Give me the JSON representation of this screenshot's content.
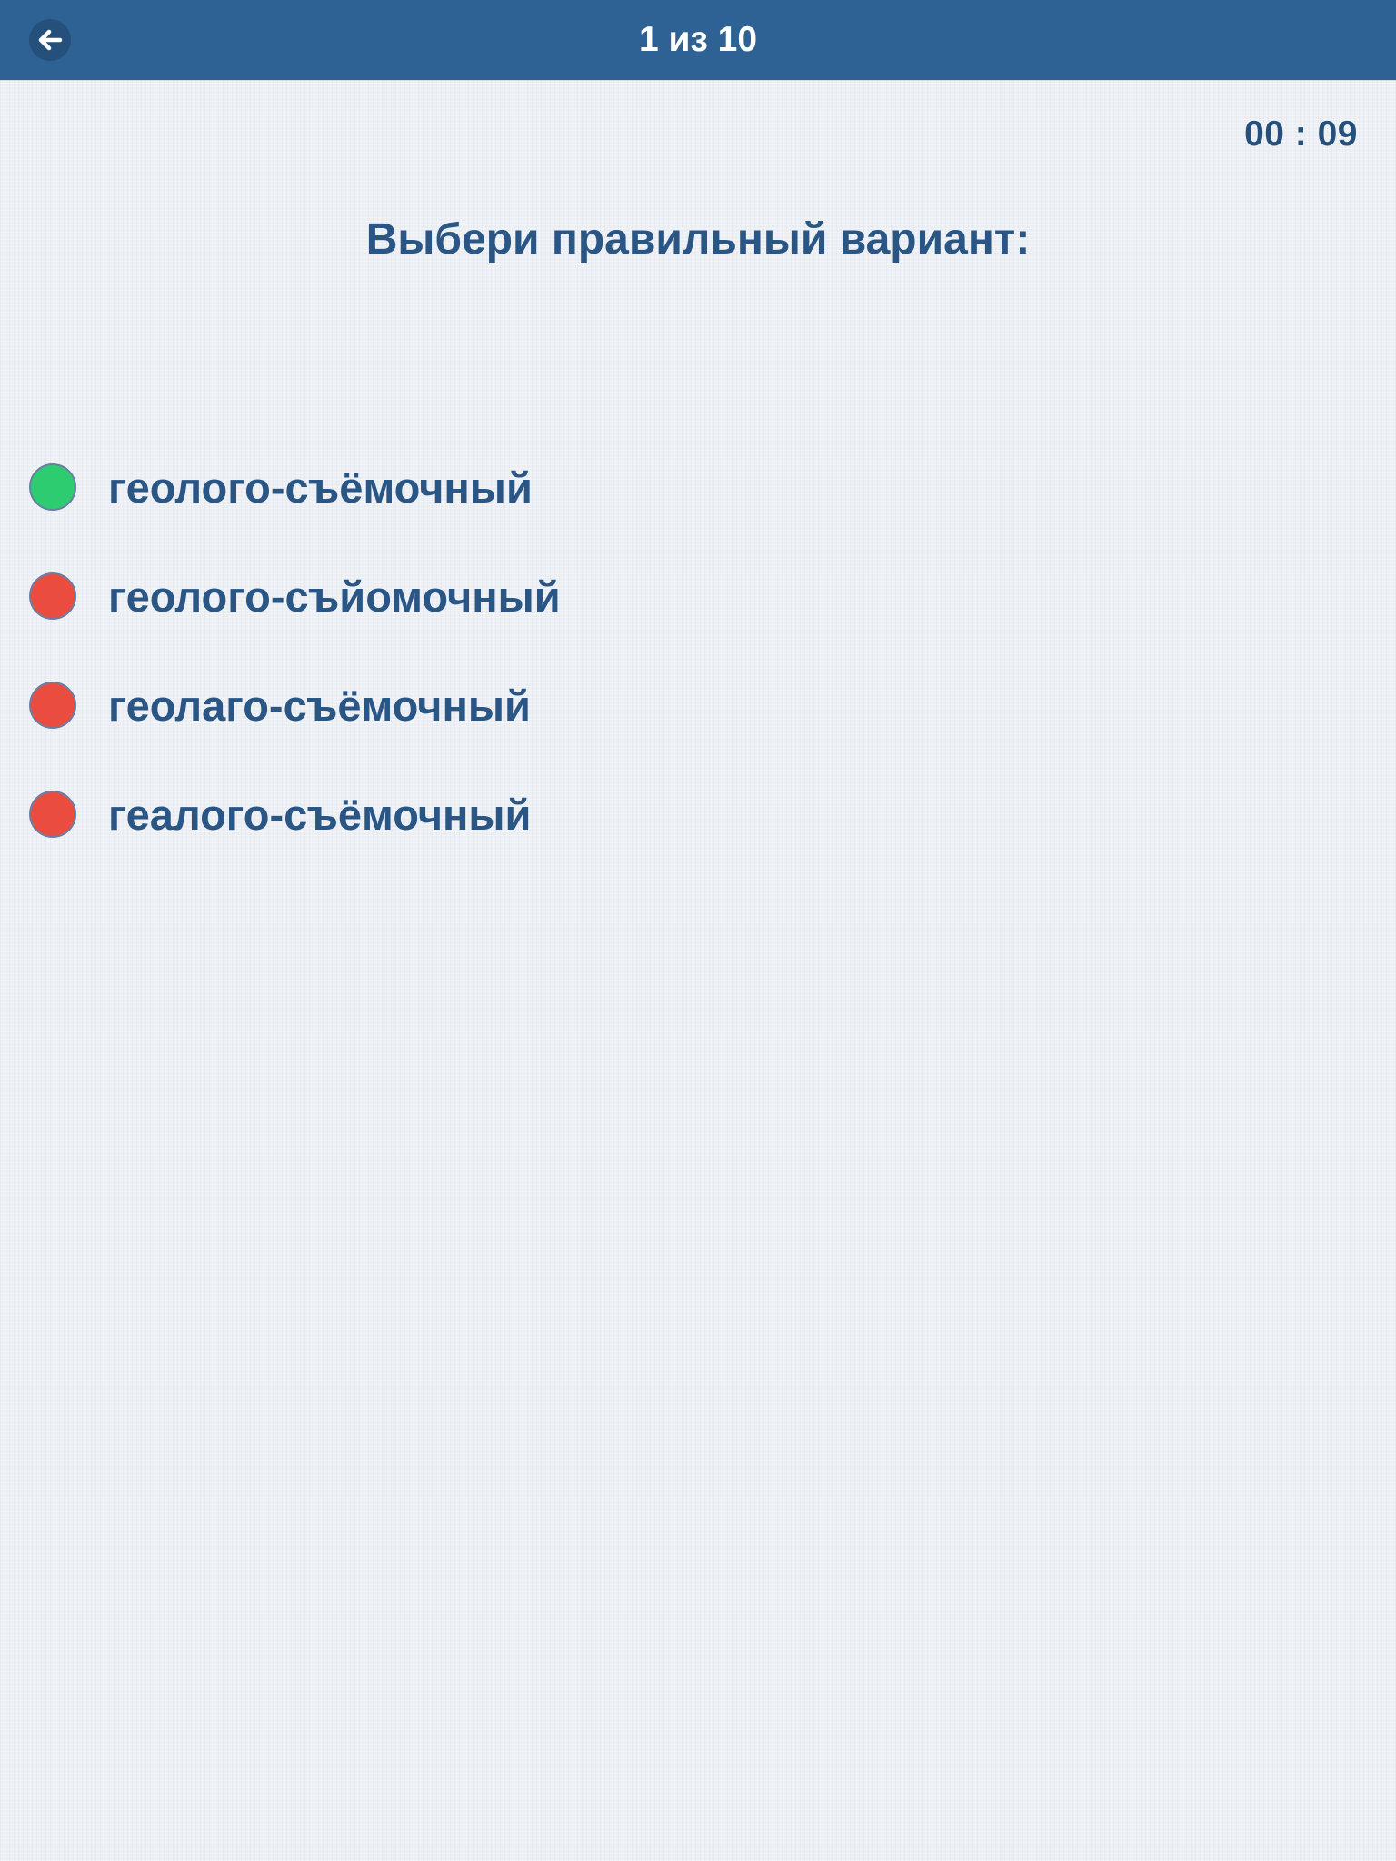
{
  "header": {
    "back_icon": "arrow-left-icon",
    "title": "1 из 10"
  },
  "timer": {
    "value": "00 : 09"
  },
  "question": {
    "prompt": "Выбери правильный вариант:"
  },
  "colors": {
    "header_bg": "#2e6294",
    "text": "#2a5685",
    "correct": "#2ecc71",
    "wrong": "#ea4c3f"
  },
  "options": [
    {
      "label": "геолого-съёмочный",
      "status": "correct",
      "color": "#2ecc71"
    },
    {
      "label": "геолого-съйомочный",
      "status": "wrong",
      "color": "#ea4c3f"
    },
    {
      "label": "геолаго-съёмочный",
      "status": "wrong",
      "color": "#ea4c3f"
    },
    {
      "label": "геалого-съёмочный",
      "status": "wrong",
      "color": "#ea4c3f"
    }
  ]
}
